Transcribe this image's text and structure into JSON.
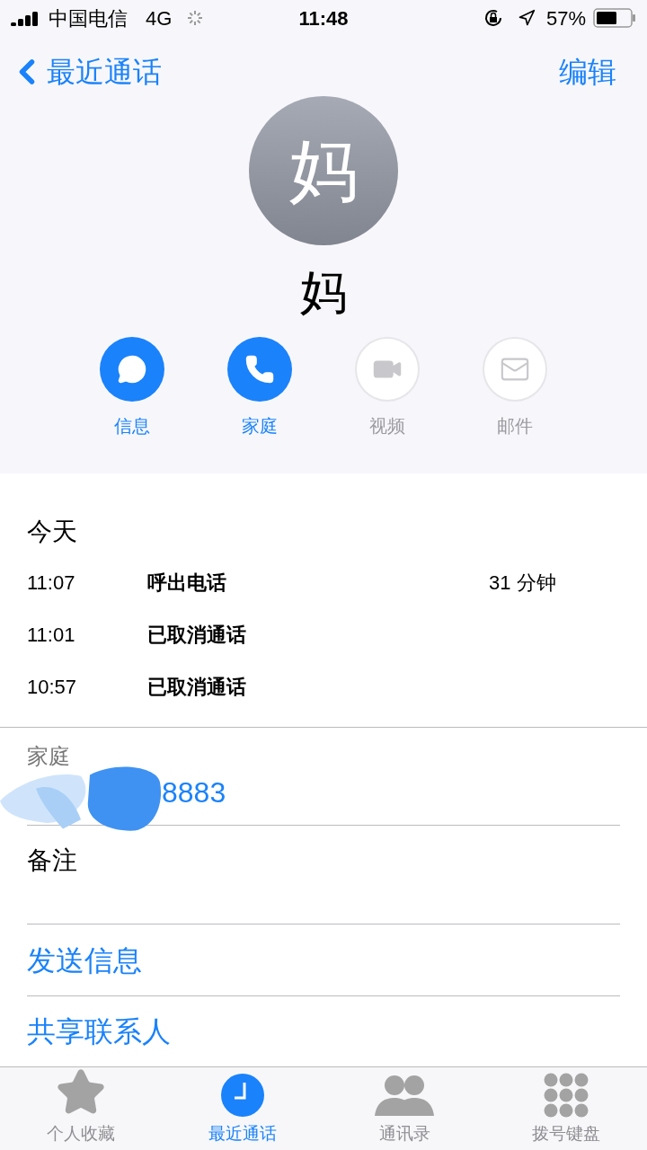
{
  "status_bar": {
    "carrier": "中国电信",
    "network": "4G",
    "time": "11:48",
    "battery": "57%"
  },
  "nav": {
    "back": "最近通话",
    "action": "编辑"
  },
  "contact": {
    "avatar": "妈",
    "name": "妈"
  },
  "actions": [
    {
      "kind": "message",
      "label": "信息",
      "disabled": false
    },
    {
      "kind": "phone",
      "label": "家庭",
      "disabled": false
    },
    {
      "kind": "video",
      "label": "视频",
      "disabled": true
    },
    {
      "kind": "mail",
      "label": "邮件",
      "disabled": true
    }
  ],
  "calls": {
    "heading": "今天",
    "rows": [
      {
        "time": "11:07",
        "type": "呼出电话",
        "duration": "31 分钟"
      },
      {
        "time": "11:01",
        "type": "已取消通话"
      },
      {
        "time": "10:57",
        "type": "已取消通话"
      }
    ]
  },
  "phone": {
    "label": "家庭",
    "number": "8883"
  },
  "notes": {
    "label": "备注"
  },
  "links": [
    "发送信息",
    "共享联系人"
  ],
  "tabs": [
    {
      "kind": "star",
      "label": "个人收藏",
      "selected": false
    },
    {
      "kind": "clock",
      "label": "最近通话",
      "selected": true
    },
    {
      "kind": "people",
      "label": "通讯录",
      "selected": false
    },
    {
      "kind": "keypad",
      "label": "拨号键盘",
      "selected": false
    }
  ]
}
